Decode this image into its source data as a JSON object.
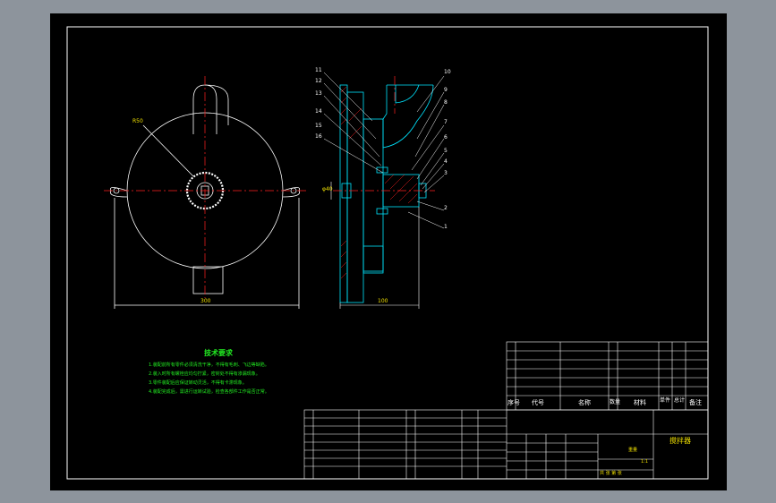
{
  "tech_requirements": {
    "title": "技术要求",
    "lines": [
      "1.装配前所有零件必须清洗干净，不得有毛刺、飞边等缺陷。",
      "2.装入时所有螺栓应均匀拧紧，密封处不得有渗漏现象。",
      "3.零件装配后应保证转动灵活，不得有卡滞现象。",
      "4.装配完成后，需进行运转试验，检查各部件工作是否正常。"
    ]
  },
  "dimensions": {
    "diameter": "R50",
    "width_left": "300",
    "width_right": "100",
    "height_mark": "φ40"
  },
  "balloons": [
    "1",
    "2",
    "3",
    "4",
    "5",
    "6",
    "7",
    "8",
    "9",
    "10",
    "11",
    "12",
    "13",
    "14",
    "15",
    "16"
  ],
  "title_block": {
    "drawing_name": "搅拌器",
    "scale": "1:1",
    "header_labels": [
      "序号",
      "代号",
      "名称",
      "数量",
      "材料",
      "单件",
      "总计",
      "备注"
    ],
    "weight_label": "重量",
    "sheet_label": "共 张 第 张"
  },
  "colors": {
    "line": "#ffffff",
    "centerline": "#ff2020",
    "section": "#00e5ff",
    "hatch": "#ff2020",
    "text_green": "#22ee22",
    "text_yellow": "#f0e000"
  }
}
